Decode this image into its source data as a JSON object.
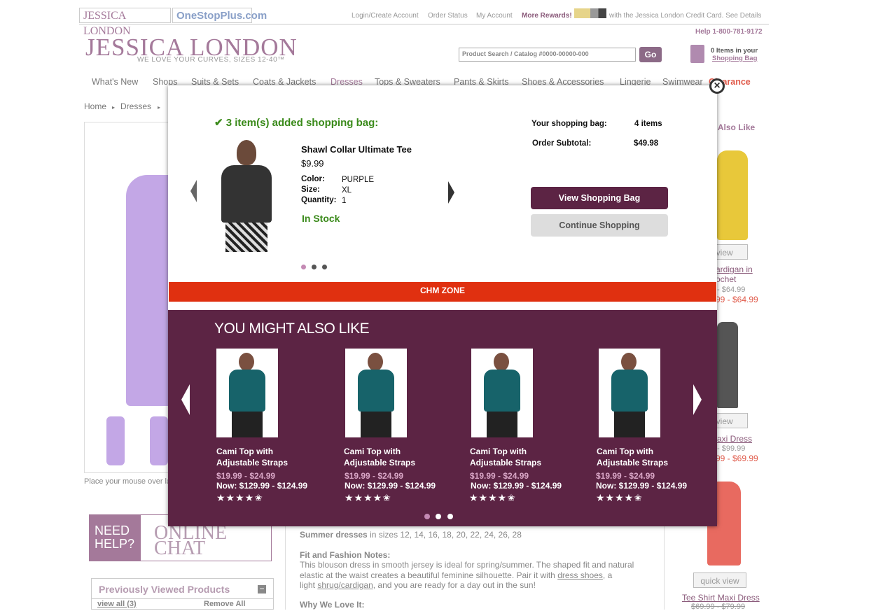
{
  "brand_tabs": [
    "JESSICA LONDON",
    "OneStopPlus.com"
  ],
  "utility": {
    "login": "Login/Create Account",
    "order_status": "Order Status",
    "my_account": "My Account",
    "rewards": "More Rewards!",
    "rewards_text": "with the Jessica London Credit Card. See Details",
    "help": "Help 1-800-781-9172"
  },
  "logo": {
    "name": "JESSICA LONDON",
    "tagline": "WE LOVE YOUR CURVES, SIZES 12-40™"
  },
  "search": {
    "placeholder": "Product Search / Catalog #0000-00000-000",
    "go": "Go"
  },
  "bag": {
    "count_text": "0 Items in your",
    "link": "Shopping Bag"
  },
  "nav": [
    "What's New",
    "Shops",
    "Suits & Sets",
    "Coats & Jackets",
    "Dresses",
    "Tops & Sweaters",
    "Pants & Skirts",
    "Shoes & Accessories",
    "Lingerie",
    "Swimwear",
    "Clearance"
  ],
  "breadcrumb": [
    "Home",
    "Dresses"
  ],
  "page": {
    "caption": "Place your mouse over la",
    "need_help": "NEED HELP?",
    "online_chat": "ONLINE CHAT",
    "prev_viewed": "Previously Viewed Products",
    "view_all": "view all (3)",
    "remove_all": "Remove All",
    "summer_label": "Summer dresses",
    "summer_sizes": "in sizes 12, 14, 16, 18, 20, 22, 24, 26, 28",
    "fit_title": "Fit and Fashion Notes:",
    "fit_line1": "This blouson dress in smooth jersey is ideal for spring/summer. The shaped fit and natural",
    "fit_line2a": "elastic at the waist creates a beautiful feminine silhouette. Pair it with",
    "fit_link1": "dress shoes",
    "fit_line2b": ", a",
    "fit_line3a": "light",
    "fit_link2": "shrug/cardigan",
    "fit_line3b": ", and you are ready for a day out in the sun!",
    "why": "Why We Love It:",
    "side_title": "t Also Like",
    "side_items": [
      {
        "qv": "k view",
        "name1": "ardigan in",
        "name2": "ochet",
        "old": "- $64.99",
        "now": "99 - $64.99"
      },
      {
        "qv": "k view",
        "name1": "axi Dress",
        "old": "- $99.99",
        "now": "99 - $69.99"
      },
      {
        "qv": "quick view",
        "name1": "Tee Shirt Maxi Dress",
        "old": "$69.99 - $79.99"
      }
    ]
  },
  "modal": {
    "added": "3 item(s) added shopping bag:",
    "product": {
      "name": "Shawl Collar Ultimate Tee",
      "price": "$9.99",
      "color_label": "Color:",
      "color": "PURPLE",
      "size_label": "Size:",
      "size": "XL",
      "qty_label": "Quantity:",
      "qty": "1",
      "stock": "In Stock"
    },
    "summary": {
      "bag_label": "Your shopping bag:",
      "bag_value": "4 items",
      "subtotal_label": "Order Subtotal:",
      "subtotal_value": "$49.98"
    },
    "view_bag": "View Shopping Bag",
    "continue": "Continue Shopping",
    "chm": "CHM ZONE",
    "ymal_title": "YOU MIGHT ALSO LIKE",
    "cards": [
      {
        "name1": "Cami Top with",
        "name2": "Adjustable Straps",
        "old": "$19.99 - $24.99",
        "now": "Now: $129.99 - $124.99",
        "rating": 4.5
      },
      {
        "name1": "Cami Top with",
        "name2": "Adjustable Straps",
        "old": "$19.99 - $24.99",
        "now": "Now: $129.99 - $124.99",
        "rating": 4.5
      },
      {
        "name1": "Cami Top with",
        "name2": "Adjustable Straps",
        "old": "$19.99 - $24.99",
        "now": "Now: $129.99 - $124.99",
        "rating": 4.5
      },
      {
        "name1": "Cami Top with",
        "name2": "Adjustable Straps",
        "old": "$19.99 - $24.99",
        "now": "Now: $129.99 - $124.99",
        "rating": 4.5
      }
    ]
  },
  "colors": {
    "brand": "#a4799a",
    "plum": "#5c2444",
    "chm": "#e03010",
    "stock": "#3a8a1a"
  }
}
